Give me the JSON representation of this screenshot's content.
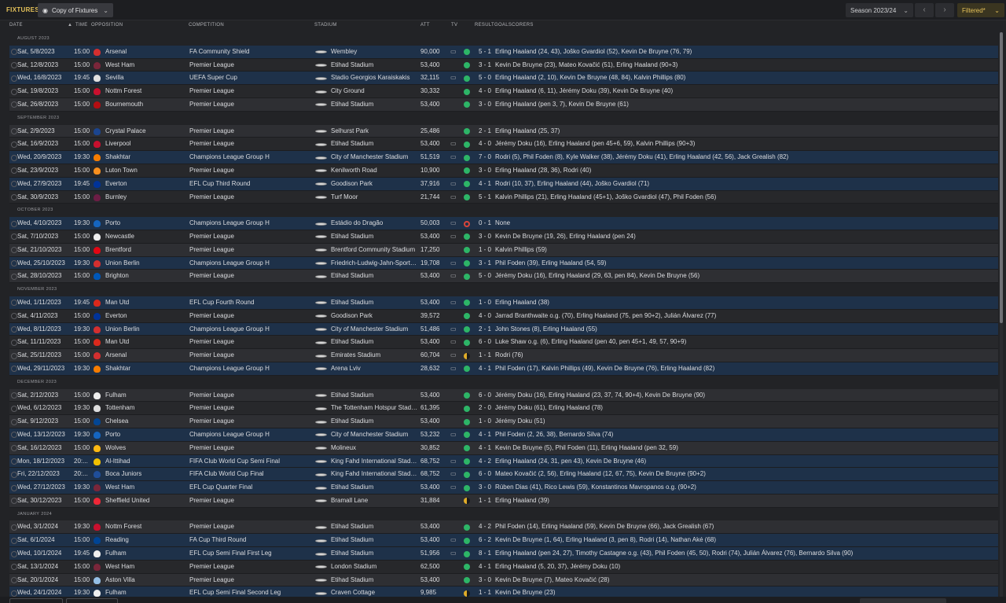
{
  "header": {
    "title": "FIXTURES",
    "view_label": "Copy of Fixtures",
    "season_label": "Season 2023/24",
    "filter_label": "Filtered*"
  },
  "columns": {
    "date": "DATE",
    "time": "TIME",
    "opposition": "OPPOSITION",
    "competition": "COMPETITION",
    "stadium": "STADIUM",
    "att": "ATT",
    "tv": "TV",
    "result": "RESULT",
    "goalscorers": "GOALSCORERS"
  },
  "colors": {
    "win": "#2db567",
    "draw": "#e0ac28",
    "loss": "#d9443a",
    "cup_row": "#1e3149",
    "accent": "#e5c25a"
  },
  "fixtures": [
    {
      "month": "AUGUST 2023"
    },
    {
      "date": "Sat, 5/8/2023",
      "time": "15:00",
      "opp": "Arsenal",
      "crest": "#d32f2f",
      "comp": "FA Community Shield",
      "stadium": "Wembley",
      "att": "90,000",
      "tv": "▭",
      "outcome": "win",
      "result": "5 - 1",
      "scorers": "Erling Haaland (24, 43), Joško Gvardiol (52), Kevin De Bruyne (76, 79)"
    },
    {
      "date": "Sat, 12/8/2023",
      "time": "15:00",
      "opp": "West Ham",
      "crest": "#7a263a",
      "comp": "Premier League",
      "stadium": "Etihad Stadium",
      "att": "53,400",
      "tv": "",
      "outcome": "win",
      "result": "3 - 1",
      "scorers": "Kevin De Bruyne (23), Mateo Kovačić (51), Erling Haaland (90+3)"
    },
    {
      "date": "Wed, 16/8/2023",
      "time": "19:45",
      "opp": "Sevilla",
      "crest": "#e0e0e0",
      "comp": "UEFA Super Cup",
      "stadium": "Stadio Georgios Karaiskakis",
      "att": "32,115",
      "tv": "▭",
      "outcome": "win",
      "result": "5 - 0",
      "scorers": "Erling Haaland (2, 10), Kevin De Bruyne (48, 84), Kalvin Phillips (80)"
    },
    {
      "date": "Sat, 19/8/2023",
      "time": "15:00",
      "opp": "Nottm Forest",
      "crest": "#c8102e",
      "comp": "Premier League",
      "stadium": "City Ground",
      "att": "30,332",
      "tv": "",
      "outcome": "win",
      "result": "4 - 0",
      "scorers": "Erling Haaland (6, 11), Jérémy Doku (39), Kevin De Bruyne (40)"
    },
    {
      "date": "Sat, 26/8/2023",
      "time": "15:00",
      "opp": "Bournemouth",
      "crest": "#b50e12",
      "comp": "Premier League",
      "stadium": "Etihad Stadium",
      "att": "53,400",
      "tv": "",
      "outcome": "win",
      "result": "3 - 0",
      "scorers": "Erling Haaland (pen 3, 7), Kevin De Bruyne (61)"
    },
    {
      "month": "SEPTEMBER 2023"
    },
    {
      "date": "Sat, 2/9/2023",
      "time": "15:00",
      "opp": "Crystal Palace",
      "crest": "#1b458f",
      "comp": "Premier League",
      "stadium": "Selhurst Park",
      "att": "25,486",
      "tv": "",
      "outcome": "win",
      "result": "2 - 1",
      "scorers": "Erling Haaland (25, 37)"
    },
    {
      "date": "Sat, 16/9/2023",
      "time": "15:00",
      "opp": "Liverpool",
      "crest": "#c8102e",
      "comp": "Premier League",
      "stadium": "Etihad Stadium",
      "att": "53,400",
      "tv": "▭",
      "outcome": "win",
      "result": "4 - 0",
      "scorers": "Jérémy Doku (16), Erling Haaland (pen 45+6, 59), Kalvin Phillips (90+3)"
    },
    {
      "date": "Wed, 20/9/2023",
      "time": "19:30",
      "opp": "Shakhtar",
      "crest": "#f57c00",
      "comp": "Champions League Group H",
      "stadium": "City of Manchester Stadium",
      "att": "51,519",
      "tv": "▭",
      "outcome": "win",
      "result": "7 - 0",
      "scorers": "Rodri (5), Phil Foden (8), Kyle Walker (38), Jérémy Doku (41), Erling Haaland (42, 56), Jack Grealish (82)"
    },
    {
      "date": "Sat, 23/9/2023",
      "time": "15:00",
      "opp": "Luton Town",
      "crest": "#f78f1e",
      "comp": "Premier League",
      "stadium": "Kenilworth Road",
      "att": "10,900",
      "tv": "",
      "outcome": "win",
      "result": "3 - 0",
      "scorers": "Erling Haaland (28, 36), Rodri (40)"
    },
    {
      "date": "Wed, 27/9/2023",
      "time": "19:45",
      "opp": "Everton",
      "crest": "#003399",
      "comp": "EFL Cup Third Round",
      "stadium": "Goodison Park",
      "att": "37,916",
      "tv": "▭",
      "outcome": "win",
      "result": "4 - 1",
      "scorers": "Rodri (10, 37), Erling Haaland (44), Joško Gvardiol (71)"
    },
    {
      "date": "Sat, 30/9/2023",
      "time": "15:00",
      "opp": "Burnley",
      "crest": "#6c1d45",
      "comp": "Premier League",
      "stadium": "Turf Moor",
      "att": "21,744",
      "tv": "▭",
      "outcome": "win",
      "result": "5 - 1",
      "scorers": "Kalvin Phillips (21), Erling Haaland (45+1), Joško Gvardiol (47), Phil Foden (56)"
    },
    {
      "month": "OCTOBER 2023"
    },
    {
      "date": "Wed, 4/10/2023",
      "time": "19:30",
      "opp": "Porto",
      "crest": "#1565c0",
      "comp": "Champions League Group H",
      "stadium": "Estádio do Dragão",
      "att": "50,003",
      "tv": "▭",
      "outcome": "loss",
      "result": "0 - 1",
      "scorers": "None"
    },
    {
      "date": "Sat, 7/10/2023",
      "time": "15:00",
      "opp": "Newcastle",
      "crest": "#eeeeee",
      "comp": "Premier League",
      "stadium": "Etihad Stadium",
      "att": "53,400",
      "tv": "▭",
      "outcome": "win",
      "result": "3 - 0",
      "scorers": "Kevin De Bruyne (19, 26), Erling Haaland (pen 24)"
    },
    {
      "date": "Sat, 21/10/2023",
      "time": "15:00",
      "opp": "Brentford",
      "crest": "#e30613",
      "comp": "Premier League",
      "stadium": "Brentford Community Stadium",
      "att": "17,250",
      "tv": "",
      "outcome": "win",
      "result": "1 - 0",
      "scorers": "Kalvin Phillips (59)"
    },
    {
      "date": "Wed, 25/10/2023",
      "time": "19:30",
      "opp": "Union Berlin",
      "crest": "#d32f2f",
      "comp": "Champions League Group H",
      "stadium": "Friedrich-Ludwig-Jahn-Sportpark",
      "att": "19,708",
      "tv": "▭",
      "outcome": "win",
      "result": "3 - 1",
      "scorers": "Phil Foden (39), Erling Haaland (54, 59)"
    },
    {
      "date": "Sat, 28/10/2023",
      "time": "15:00",
      "opp": "Brighton",
      "crest": "#0057b8",
      "comp": "Premier League",
      "stadium": "Etihad Stadium",
      "att": "53,400",
      "tv": "▭",
      "outcome": "win",
      "result": "5 - 0",
      "scorers": "Jérémy Doku (16), Erling Haaland (29, 63, pen 84), Kevin De Bruyne (56)"
    },
    {
      "month": "NOVEMBER 2023"
    },
    {
      "date": "Wed, 1/11/2023",
      "time": "19:45",
      "opp": "Man Utd",
      "crest": "#da291c",
      "comp": "EFL Cup Fourth Round",
      "stadium": "Etihad Stadium",
      "att": "53,400",
      "tv": "▭",
      "outcome": "win",
      "result": "1 - 0",
      "scorers": "Erling Haaland (38)"
    },
    {
      "date": "Sat, 4/11/2023",
      "time": "15:00",
      "opp": "Everton",
      "crest": "#003399",
      "comp": "Premier League",
      "stadium": "Goodison Park",
      "att": "39,572",
      "tv": "",
      "outcome": "win",
      "result": "4 - 0",
      "scorers": "Jarrad Branthwaite o.g. (70), Erling Haaland (75, pen 90+2), Julián Álvarez (77)"
    },
    {
      "date": "Wed, 8/11/2023",
      "time": "19:30",
      "opp": "Union Berlin",
      "crest": "#d32f2f",
      "comp": "Champions League Group H",
      "stadium": "City of Manchester Stadium",
      "att": "51,486",
      "tv": "▭",
      "outcome": "win",
      "result": "2 - 1",
      "scorers": "John Stones (8), Erling Haaland (55)"
    },
    {
      "date": "Sat, 11/11/2023",
      "time": "15:00",
      "opp": "Man Utd",
      "crest": "#da291c",
      "comp": "Premier League",
      "stadium": "Etihad Stadium",
      "att": "53,400",
      "tv": "▭",
      "outcome": "win",
      "result": "6 - 0",
      "scorers": "Luke Shaw o.g. (6), Erling Haaland (pen 40, pen 45+1, 49, 57, 90+9)"
    },
    {
      "date": "Sat, 25/11/2023",
      "time": "15:00",
      "opp": "Arsenal",
      "crest": "#d32f2f",
      "comp": "Premier League",
      "stadium": "Emirates Stadium",
      "att": "60,704",
      "tv": "▭",
      "outcome": "draw",
      "result": "1 - 1",
      "scorers": "Rodri (76)"
    },
    {
      "date": "Wed, 29/11/2023",
      "time": "19:30",
      "opp": "Shakhtar",
      "crest": "#f57c00",
      "comp": "Champions League Group H",
      "stadium": "Arena Lviv",
      "att": "28,632",
      "tv": "▭",
      "outcome": "win",
      "result": "4 - 1",
      "scorers": "Phil Foden (17), Kalvin Phillips (49), Kevin De Bruyne (76), Erling Haaland (82)"
    },
    {
      "month": "DECEMBER 2023"
    },
    {
      "date": "Sat, 2/12/2023",
      "time": "15:00",
      "opp": "Fulham",
      "crest": "#eeeeee",
      "comp": "Premier League",
      "stadium": "Etihad Stadium",
      "att": "53,400",
      "tv": "",
      "outcome": "win",
      "result": "6 - 0",
      "scorers": "Jérémy Doku (16), Erling Haaland (23, 37, 74, 90+4), Kevin De Bruyne (90)"
    },
    {
      "date": "Wed, 6/12/2023",
      "time": "19:30",
      "opp": "Tottenham",
      "crest": "#dddddd",
      "comp": "Premier League",
      "stadium": "The Tottenham Hotspur Stadium",
      "att": "61,395",
      "tv": "",
      "outcome": "win",
      "result": "2 - 0",
      "scorers": "Jérémy Doku (61), Erling Haaland (78)"
    },
    {
      "date": "Sat, 9/12/2023",
      "time": "15:00",
      "opp": "Chelsea",
      "crest": "#034694",
      "comp": "Premier League",
      "stadium": "Etihad Stadium",
      "att": "53,400",
      "tv": "",
      "outcome": "win",
      "result": "1 - 0",
      "scorers": "Jérémy Doku (51)"
    },
    {
      "date": "Wed, 13/12/2023",
      "time": "19:30",
      "opp": "Porto",
      "crest": "#1565c0",
      "comp": "Champions League Group H",
      "stadium": "City of Manchester Stadium",
      "att": "53,232",
      "tv": "▭",
      "outcome": "win",
      "result": "4 - 1",
      "scorers": "Phil Foden (2, 26, 38), Bernardo Silva (74)"
    },
    {
      "date": "Sat, 16/12/2023",
      "time": "15:00",
      "opp": "Wolves",
      "crest": "#fdb913",
      "comp": "Premier League",
      "stadium": "Molineux",
      "att": "30,852",
      "tv": "",
      "outcome": "win",
      "result": "4 - 1",
      "scorers": "Kevin De Bruyne (5), Phil Foden (11), Erling Haaland (pen 32, 59)"
    },
    {
      "date": "Mon, 18/12/2023",
      "time": "20:...",
      "opp": "Al-Ittihad",
      "crest": "#f2c000",
      "comp": "FIFA Club World Cup Semi Final",
      "stadium": "King Fahd International Stadium",
      "att": "68,752",
      "tv": "▭",
      "outcome": "win",
      "result": "4 - 2",
      "scorers": "Erling Haaland (24, 31, pen 43), Kevin De Bruyne (46)"
    },
    {
      "date": "Fri, 22/12/2023",
      "time": "20:...",
      "opp": "Boca Juniors",
      "crest": "#1f4e9a",
      "comp": "FIFA Club World Cup Final",
      "stadium": "King Fahd International Stadium",
      "att": "68,752",
      "tv": "▭",
      "outcome": "win",
      "result": "6 - 0",
      "scorers": "Mateo Kovačić (2, 56), Erling Haaland (12, 67, 75), Kevin De Bruyne (90+2)"
    },
    {
      "date": "Wed, 27/12/2023",
      "time": "19:30",
      "opp": "West Ham",
      "crest": "#7a263a",
      "comp": "EFL Cup Quarter Final",
      "stadium": "Etihad Stadium",
      "att": "53,400",
      "tv": "▭",
      "outcome": "win",
      "result": "3 - 0",
      "scorers": "Rúben Dias (41), Rico Lewis (59), Konstantinos Mavropanos o.g. (90+2)"
    },
    {
      "date": "Sat, 30/12/2023",
      "time": "15:00",
      "opp": "Sheffield United",
      "crest": "#ee2737",
      "comp": "Premier League",
      "stadium": "Bramall Lane",
      "att": "31,884",
      "tv": "",
      "outcome": "draw",
      "result": "1 - 1",
      "scorers": "Erling Haaland (39)"
    },
    {
      "month": "JANUARY 2024"
    },
    {
      "date": "Wed, 3/1/2024",
      "time": "19:30",
      "opp": "Nottm Forest",
      "crest": "#c8102e",
      "comp": "Premier League",
      "stadium": "Etihad Stadium",
      "att": "53,400",
      "tv": "",
      "outcome": "win",
      "result": "4 - 2",
      "scorers": "Phil Foden (14), Erling Haaland (59), Kevin De Bruyne (66), Jack Grealish (67)"
    },
    {
      "date": "Sat, 6/1/2024",
      "time": "15:00",
      "opp": "Reading",
      "crest": "#004494",
      "comp": "FA Cup Third Round",
      "stadium": "Etihad Stadium",
      "att": "53,400",
      "tv": "▭",
      "outcome": "win",
      "result": "6 - 2",
      "scorers": "Kevin De Bruyne (1, 64), Erling Haaland (3, pen 8), Rodri (14), Nathan Aké (68)"
    },
    {
      "date": "Wed, 10/1/2024",
      "time": "19:45",
      "opp": "Fulham",
      "crest": "#eeeeee",
      "comp": "EFL Cup Semi Final First Leg",
      "stadium": "Etihad Stadium",
      "att": "51,956",
      "tv": "▭",
      "outcome": "win",
      "result": "8 - 1",
      "scorers": "Erling Haaland (pen 24, 27), Timothy Castagne o.g. (43), Phil Foden (45, 50), Rodri (74), Julián Álvarez (76), Bernardo Silva (90)"
    },
    {
      "date": "Sat, 13/1/2024",
      "time": "15:00",
      "opp": "West Ham",
      "crest": "#7a263a",
      "comp": "Premier League",
      "stadium": "London Stadium",
      "att": "62,500",
      "tv": "",
      "outcome": "win",
      "result": "4 - 1",
      "scorers": "Erling Haaland (5, 20, 37), Jérémy Doku (10)"
    },
    {
      "date": "Sat, 20/1/2024",
      "time": "15:00",
      "opp": "Aston Villa",
      "crest": "#95bfe5",
      "comp": "Premier League",
      "stadium": "Etihad Stadium",
      "att": "53,400",
      "tv": "",
      "outcome": "win",
      "result": "3 - 0",
      "scorers": "Kevin De Bruyne (7), Mateo Kovačić (28)"
    },
    {
      "date": "Wed, 24/1/2024",
      "time": "19:30",
      "opp": "Fulham",
      "crest": "#eeeeee",
      "comp": "EFL Cup Semi Final Second Leg",
      "stadium": "Craven Cottage",
      "att": "9,985",
      "tv": "",
      "outcome": "draw",
      "result": "1 - 1",
      "scorers": "Kevin De Bruyne (23)"
    }
  ]
}
